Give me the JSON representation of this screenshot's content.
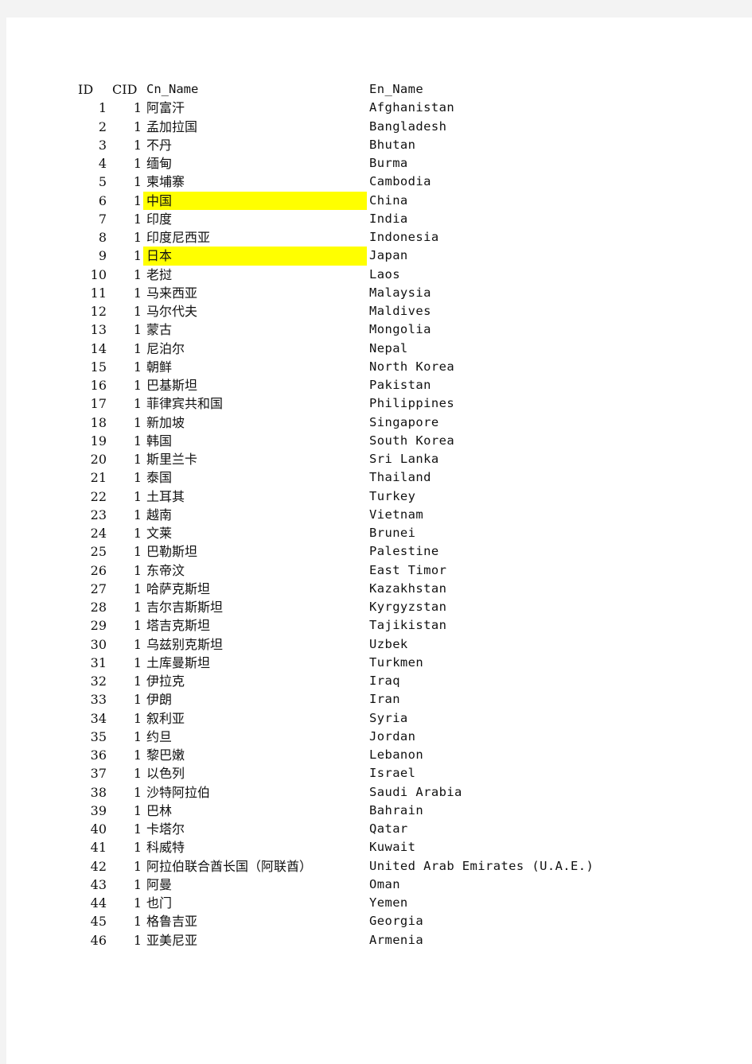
{
  "header": {
    "id": "ID",
    "cid": "CID",
    "cn_name": "Cn_Name",
    "en_name": "En_Name"
  },
  "highlight_color": "#ffff00",
  "rows": [
    {
      "id": "1",
      "cid": "1",
      "cn": "阿富汗",
      "en": "Afghanistan",
      "highlight": false
    },
    {
      "id": "2",
      "cid": "1",
      "cn": "孟加拉国",
      "en": "Bangladesh",
      "highlight": false
    },
    {
      "id": "3",
      "cid": "1",
      "cn": "不丹",
      "en": "Bhutan",
      "highlight": false
    },
    {
      "id": "4",
      "cid": "1",
      "cn": "缅甸",
      "en": "Burma",
      "highlight": false
    },
    {
      "id": "5",
      "cid": "1",
      "cn": "柬埔寨",
      "en": "Cambodia",
      "highlight": false
    },
    {
      "id": "6",
      "cid": "1",
      "cn": "中国",
      "en": "China",
      "highlight": true
    },
    {
      "id": "7",
      "cid": "1",
      "cn": "印度",
      "en": "India",
      "highlight": false
    },
    {
      "id": "8",
      "cid": "1",
      "cn": "印度尼西亚",
      "en": "Indonesia",
      "highlight": false
    },
    {
      "id": "9",
      "cid": "1",
      "cn": "日本",
      "en": "Japan",
      "highlight": true
    },
    {
      "id": "10",
      "cid": "1",
      "cn": "老挝",
      "en": "Laos",
      "highlight": false
    },
    {
      "id": "11",
      "cid": "1",
      "cn": "马来西亚",
      "en": "Malaysia",
      "highlight": false
    },
    {
      "id": "12",
      "cid": "1",
      "cn": "马尔代夫",
      "en": "Maldives",
      "highlight": false
    },
    {
      "id": "13",
      "cid": "1",
      "cn": "蒙古",
      "en": "Mongolia",
      "highlight": false
    },
    {
      "id": "14",
      "cid": "1",
      "cn": "尼泊尔",
      "en": "Nepal",
      "highlight": false
    },
    {
      "id": "15",
      "cid": "1",
      "cn": "朝鲜",
      "en": "North Korea",
      "highlight": false
    },
    {
      "id": "16",
      "cid": "1",
      "cn": "巴基斯坦",
      "en": "Pakistan",
      "highlight": false
    },
    {
      "id": "17",
      "cid": "1",
      "cn": "菲律宾共和国",
      "en": "Philippines",
      "highlight": false
    },
    {
      "id": "18",
      "cid": "1",
      "cn": "新加坡",
      "en": "Singapore",
      "highlight": false
    },
    {
      "id": "19",
      "cid": "1",
      "cn": "韩国",
      "en": "South Korea",
      "highlight": false
    },
    {
      "id": "20",
      "cid": "1",
      "cn": "斯里兰卡",
      "en": "Sri Lanka",
      "highlight": false
    },
    {
      "id": "21",
      "cid": "1",
      "cn": "泰国",
      "en": "Thailand",
      "highlight": false
    },
    {
      "id": "22",
      "cid": "1",
      "cn": "土耳其",
      "en": "Turkey",
      "highlight": false
    },
    {
      "id": "23",
      "cid": "1",
      "cn": "越南",
      "en": "Vietnam",
      "highlight": false
    },
    {
      "id": "24",
      "cid": "1",
      "cn": "文莱",
      "en": "Brunei",
      "highlight": false
    },
    {
      "id": "25",
      "cid": "1",
      "cn": "巴勒斯坦",
      "en": "Palestine",
      "highlight": false
    },
    {
      "id": "26",
      "cid": "1",
      "cn": "东帝汶",
      "en": "East Timor",
      "highlight": false
    },
    {
      "id": "27",
      "cid": "1",
      "cn": "哈萨克斯坦",
      "en": "Kazakhstan",
      "highlight": false
    },
    {
      "id": "28",
      "cid": "1",
      "cn": "吉尔吉斯斯坦",
      "en": "Kyrgyzstan",
      "highlight": false
    },
    {
      "id": "29",
      "cid": "1",
      "cn": "塔吉克斯坦",
      "en": "Tajikistan",
      "highlight": false
    },
    {
      "id": "30",
      "cid": "1",
      "cn": "乌兹别克斯坦",
      "en": "Uzbek",
      "highlight": false
    },
    {
      "id": "31",
      "cid": "1",
      "cn": "土库曼斯坦",
      "en": "Turkmen",
      "highlight": false
    },
    {
      "id": "32",
      "cid": "1",
      "cn": "伊拉克",
      "en": "Iraq",
      "highlight": false
    },
    {
      "id": "33",
      "cid": "1",
      "cn": "伊朗",
      "en": "Iran",
      "highlight": false
    },
    {
      "id": "34",
      "cid": "1",
      "cn": "叙利亚",
      "en": "Syria",
      "highlight": false
    },
    {
      "id": "35",
      "cid": "1",
      "cn": "约旦",
      "en": "Jordan",
      "highlight": false
    },
    {
      "id": "36",
      "cid": "1",
      "cn": "黎巴嫩",
      "en": "Lebanon",
      "highlight": false
    },
    {
      "id": "37",
      "cid": "1",
      "cn": "以色列",
      "en": "Israel",
      "highlight": false
    },
    {
      "id": "38",
      "cid": "1",
      "cn": "沙特阿拉伯",
      "en": "Saudi Arabia",
      "highlight": false
    },
    {
      "id": "39",
      "cid": "1",
      "cn": "巴林",
      "en": "Bahrain",
      "highlight": false
    },
    {
      "id": "40",
      "cid": "1",
      "cn": "卡塔尔",
      "en": "Qatar",
      "highlight": false
    },
    {
      "id": "41",
      "cid": "1",
      "cn": "科威特",
      "en": "Kuwait",
      "highlight": false
    },
    {
      "id": "42",
      "cid": "1",
      "cn": "阿拉伯联合酋长国（阿联酋）",
      "en": "United Arab Emirates (U.A.E.)",
      "highlight": false
    },
    {
      "id": "43",
      "cid": "1",
      "cn": "阿曼",
      "en": "Oman",
      "highlight": false
    },
    {
      "id": "44",
      "cid": "1",
      "cn": "也门",
      "en": "Yemen",
      "highlight": false
    },
    {
      "id": "45",
      "cid": "1",
      "cn": "格鲁吉亚",
      "en": "Georgia",
      "highlight": false
    },
    {
      "id": "46",
      "cid": "1",
      "cn": "亚美尼亚",
      "en": "Armenia",
      "highlight": false
    }
  ]
}
